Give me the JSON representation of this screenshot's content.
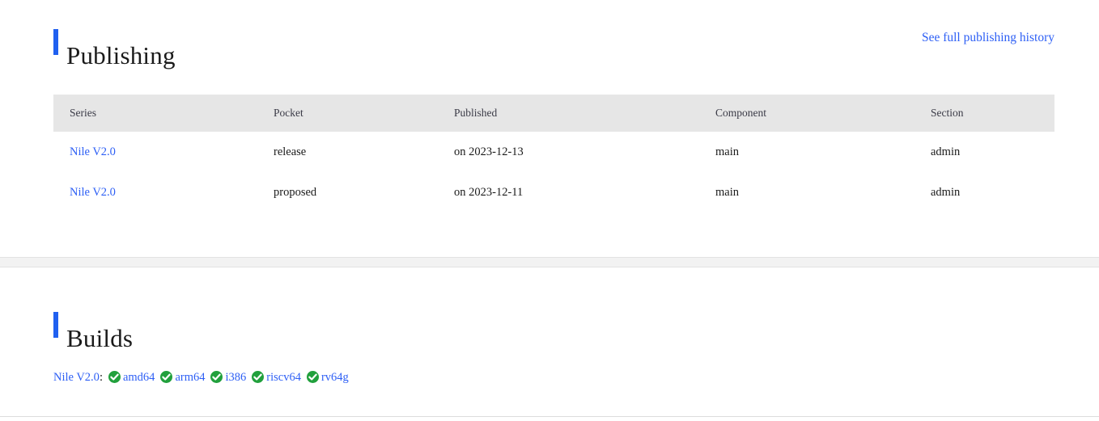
{
  "publishing": {
    "heading": "Publishing",
    "history_link": "See full publishing history",
    "accent_color": "#2060f0",
    "link_color": "#2d5ff5",
    "table": {
      "columns": [
        "Series",
        "Pocket",
        "Published",
        "Component",
        "Section"
      ],
      "rows": [
        {
          "series": "Nile V2.0",
          "pocket": "release",
          "published": "on 2023-12-13",
          "component": "main",
          "section": "admin"
        },
        {
          "series": "Nile V2.0",
          "pocket": "proposed",
          "published": "on 2023-12-11",
          "component": "main",
          "section": "admin"
        }
      ]
    }
  },
  "builds": {
    "heading": "Builds",
    "series": "Nile V2.0",
    "separator": ":",
    "badge_color": "#21a03c",
    "badge_icon": "check-circle-icon",
    "architectures": [
      {
        "name": "amd64"
      },
      {
        "name": "arm64"
      },
      {
        "name": "i386"
      },
      {
        "name": "riscv64"
      },
      {
        "name": "rv64g"
      }
    ]
  }
}
